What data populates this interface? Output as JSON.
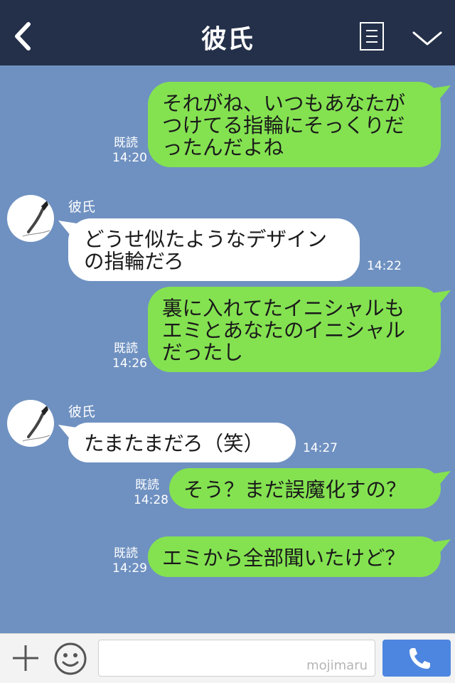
{
  "header": {
    "title": "彼氏"
  },
  "messages": [
    {
      "type": "sent",
      "lines": [
        "それがね、いつもあなたが",
        "つけてる指輪にそっくりだ",
        "ったんだよね"
      ],
      "read": "既読",
      "time": "14:20"
    },
    {
      "type": "received",
      "sender": "彼氏",
      "lines": [
        "どうせ似たようなデザイン",
        "の指輪だろ"
      ],
      "time": "14:22"
    },
    {
      "type": "sent",
      "lines": [
        "裏に入れてたイニシャルも",
        "エミとあなたのイニシャル",
        "だったし"
      ],
      "read": "既読",
      "time": "14:26"
    },
    {
      "type": "received",
      "sender": "彼氏",
      "lines": [
        "たまたまだろ（笑）"
      ],
      "time": "14:27"
    },
    {
      "type": "sent",
      "lines": [
        "そう？まだ誤魔化すの？"
      ],
      "read": "既読",
      "time": "14:28"
    },
    {
      "type": "sent",
      "lines": [
        "エミから全部聞いたけど？"
      ],
      "read": "既読",
      "time": "14:29"
    }
  ],
  "footer": {
    "watermark": "mojimaru"
  },
  "colors": {
    "header": "#243049",
    "chat_bg": "#6f91c1",
    "sent_bubble": "#84e251",
    "received_bubble": "#ffffff",
    "call_button": "#4d86e0"
  },
  "icons": {
    "back": "back-chevron-icon",
    "notes": "notes-icon",
    "menu": "chevron-down-icon",
    "plus": "plus-icon",
    "emoji": "smiley-icon",
    "call": "phone-icon"
  }
}
